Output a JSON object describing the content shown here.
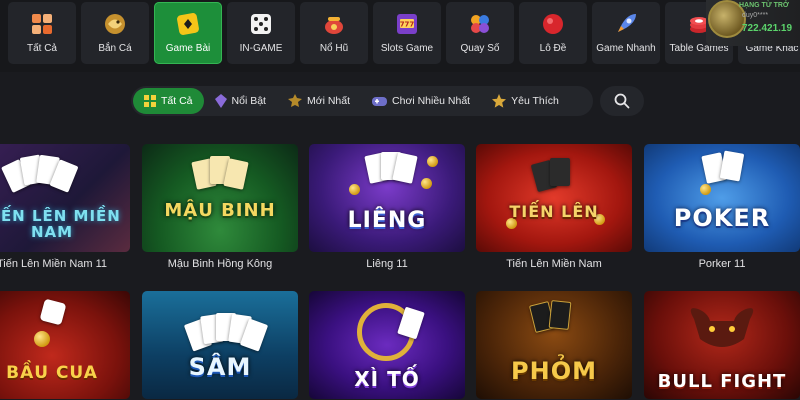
{
  "categories": [
    {
      "label": "Tất Cả",
      "icon": "grid-icon",
      "active": false
    },
    {
      "label": "Bắn Cá",
      "icon": "fish-shooting-icon",
      "active": false
    },
    {
      "label": "Game Bài",
      "icon": "card-game-icon",
      "active": true
    },
    {
      "label": "IN-GAME",
      "icon": "dice-icon",
      "active": false
    },
    {
      "label": "Nổ Hũ",
      "icon": "jackpot-pot-icon",
      "active": false
    },
    {
      "label": "Slots Game",
      "icon": "slot-machine-icon",
      "active": false
    },
    {
      "label": "Quay Số",
      "icon": "lottery-balls-icon",
      "active": false
    },
    {
      "label": "Lô Đề",
      "icon": "ball-icon",
      "active": false
    },
    {
      "label": "Game Nhanh",
      "icon": "rocket-icon",
      "active": false
    },
    {
      "label": "Table Games",
      "icon": "poker-chips-icon",
      "active": false
    },
    {
      "label": "Game Khác",
      "icon": "game-controller-icon",
      "active": false
    }
  ],
  "user": {
    "rank": "HẠNG TỪ TRỞ",
    "name": "duy0****",
    "balance": "722.421.19"
  },
  "filters": [
    {
      "label": "Tất Cả",
      "icon": "grid-icon",
      "active": true
    },
    {
      "label": "Nổi Bật",
      "icon": "gem-icon",
      "active": false
    },
    {
      "label": "Mới Nhất",
      "icon": "badge-icon",
      "active": false
    },
    {
      "label": "Chơi Nhiều Nhất",
      "icon": "gamepad-icon",
      "active": false
    },
    {
      "label": "Yêu Thích",
      "icon": "star-icon",
      "active": false
    }
  ],
  "search": {
    "icon": "search-icon"
  },
  "games": [
    {
      "title": "Tiến Lên Miền Nam 11",
      "art": "TIẾN LÊN MIỀN NAM"
    },
    {
      "title": "Mậu Binh Hồng Kông",
      "art": "MẬU BINH"
    },
    {
      "title": "Liêng 11",
      "art": "LIÊNG"
    },
    {
      "title": "Tiến Lên Miền Nam",
      "art": "TIẾN LÊN"
    },
    {
      "title": "Porker 11",
      "art": "POKER"
    },
    {
      "title": "",
      "art": "BẦU CUA"
    },
    {
      "title": "",
      "art": "SÂM"
    },
    {
      "title": "",
      "art": "XÌ TỐ"
    },
    {
      "title": "",
      "art": "PHỎM"
    },
    {
      "title": "",
      "art": "BULL FIGHT"
    }
  ],
  "colors": {
    "accent_green": "#1d8f3a",
    "background": "#1a1b1f",
    "balance_green": "#5bd36b"
  }
}
